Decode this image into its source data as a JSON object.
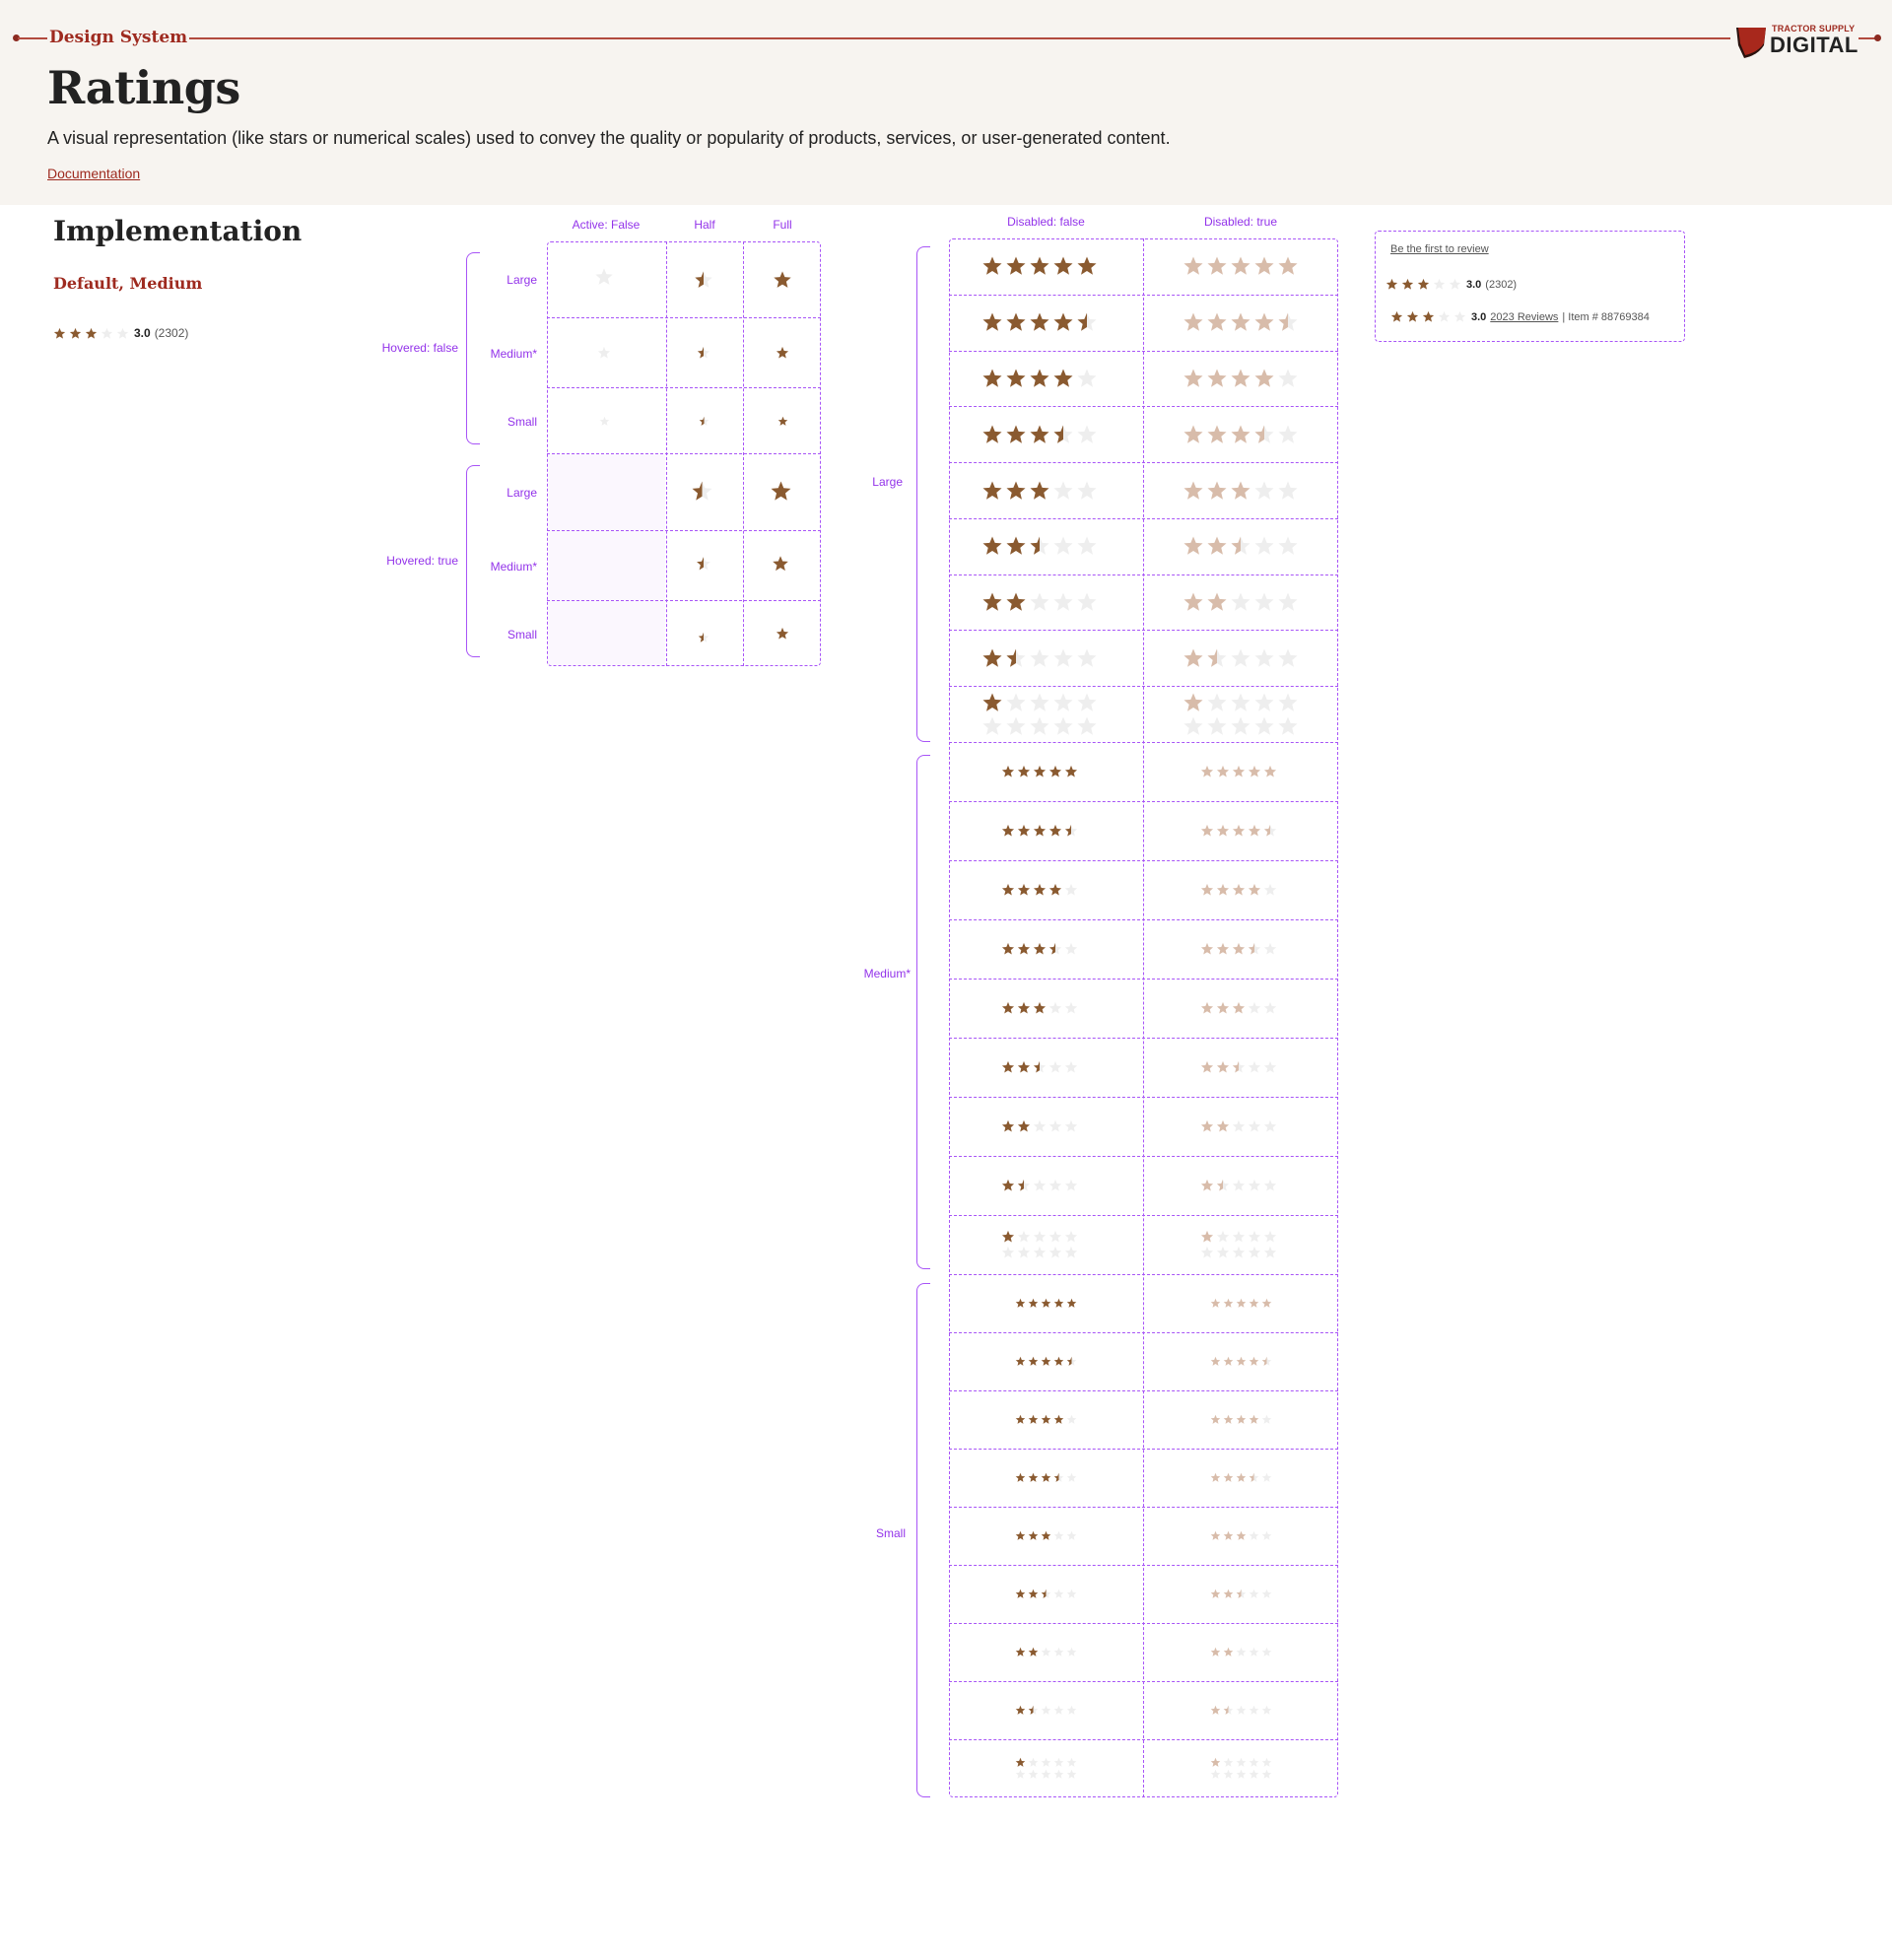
{
  "header": {
    "brand_label": "Design System",
    "title": "Ratings",
    "description": "A visual representation (like stars or numerical scales) used to convey the quality or popularity of products, services, or user-generated content.",
    "doc_link": "Documentation",
    "logo_top": "TRACTOR SUPPLY",
    "logo_main": "DIGITAL"
  },
  "implementation": {
    "title": "Implementation",
    "subtitle": "Default, Medium",
    "rating_value": "3.0",
    "rating_count": "(2302)",
    "rating_level": 3
  },
  "star_matrix": {
    "col_headers": [
      "Active: False",
      "Half",
      "Full"
    ],
    "groups": [
      {
        "label": "Hovered: false",
        "rows": [
          "Large",
          "Medium*",
          "Small"
        ]
      },
      {
        "label": "Hovered: true",
        "rows": [
          "Large",
          "Medium*",
          "Small"
        ]
      }
    ]
  },
  "rating_grid": {
    "col_headers": [
      "Disabled: false",
      "Disabled: true"
    ],
    "size_groups": [
      "Large",
      "Medium*",
      "Small"
    ],
    "rating_levels": [
      5,
      4.5,
      4,
      3.5,
      3,
      2.5,
      2,
      1.5,
      1
    ],
    "max_stars": 5
  },
  "review_card": {
    "first_review_link": "Be the first to review",
    "row1_value": "3.0",
    "row1_count": "(2302)",
    "row2_value": "3.0",
    "row2_reviews_link": "2023 Reviews",
    "row2_item": "| Item # 88769384",
    "rating_level": 3
  },
  "colors": {
    "star_active": "#8a5a30",
    "star_inactive": "#eeeeee",
    "star_disabled": "#d8bcaa",
    "annotation": "#a855f7",
    "brand": "#9e2a1f"
  }
}
